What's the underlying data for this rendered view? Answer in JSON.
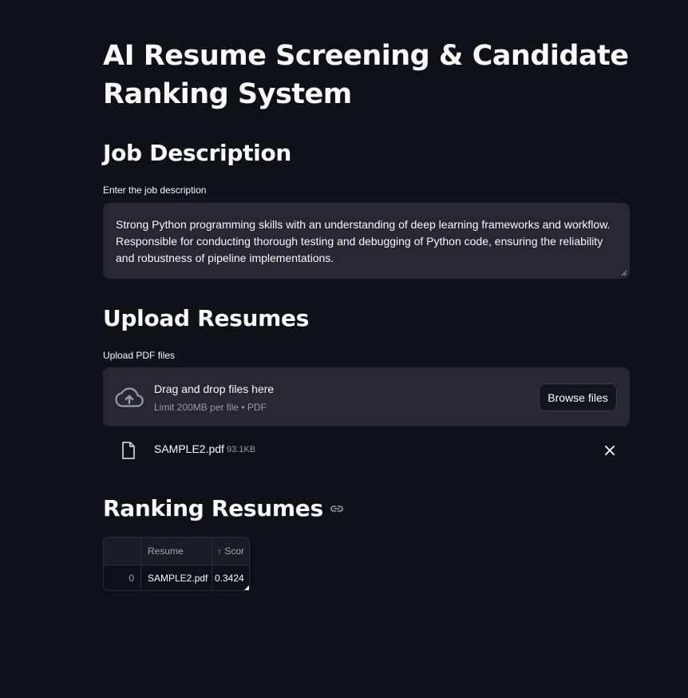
{
  "title": "AI Resume Screening & Candidate Ranking System",
  "job_section": {
    "heading": "Job Description",
    "label": "Enter the job description",
    "value": "Strong Python programming skills with an understanding of deep learning frameworks and workflow. Responsible for conducting thorough testing and debugging of Python code, ensuring the reliability and robustness of pipeline implementations."
  },
  "upload_section": {
    "heading": "Upload Resumes",
    "label": "Upload PDF files",
    "dropzone_title": "Drag and drop files here",
    "dropzone_limit": "Limit 200MB per file • PDF",
    "browse_label": "Browse files",
    "files": [
      {
        "name": "SAMPLE2.pdf",
        "size": "93.1KB"
      }
    ]
  },
  "ranking_section": {
    "heading": "Ranking Resumes",
    "table": {
      "columns": [
        "",
        "Resume",
        "↑ Scor"
      ],
      "rows": [
        {
          "index": "0",
          "resume": "SAMPLE2.pdf",
          "score": "0.3424"
        }
      ]
    }
  },
  "icons": {
    "upload": "cloud-upload-icon",
    "file": "file-icon",
    "close": "close-icon",
    "anchor": "link-icon"
  },
  "colors": {
    "background": "#0e1117",
    "surface": "#262730",
    "text": "#fafafa",
    "muted": "#9a9ca5"
  }
}
